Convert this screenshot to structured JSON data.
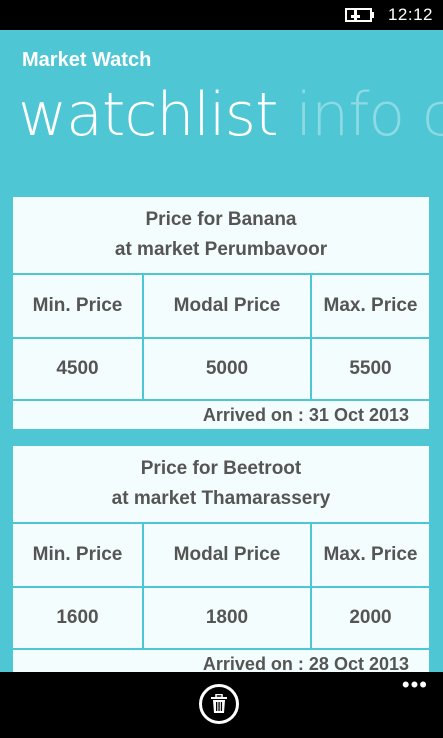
{
  "status_bar": {
    "time": "12:12",
    "battery_icon": "battery-charging-icon"
  },
  "app": {
    "title": "Market Watch",
    "pivot": {
      "active": "watchlist",
      "inactive": "info c"
    }
  },
  "cards": [
    {
      "line1": "Price for Banana",
      "line2": "at market Perumbavoor",
      "headers": [
        "Min. Price",
        "Modal Price",
        "Max. Price"
      ],
      "values": [
        "4500",
        "5000",
        "5500"
      ],
      "arrived": "Arrived on : 31 Oct 2013"
    },
    {
      "line1": "Price for Beetroot",
      "line2": "at market Thamarassery",
      "headers": [
        "Min. Price",
        "Modal Price",
        "Max. Price"
      ],
      "values": [
        "1600",
        "1800",
        "2000"
      ],
      "arrived": "Arrived on : 28 Oct 2013"
    }
  ],
  "app_bar": {
    "delete_icon": "trash-icon",
    "more_icon": "ellipsis-icon"
  },
  "colors": {
    "accent": "#4fc6d4",
    "card_bg": "#f4fdfd",
    "text": "#555555"
  }
}
